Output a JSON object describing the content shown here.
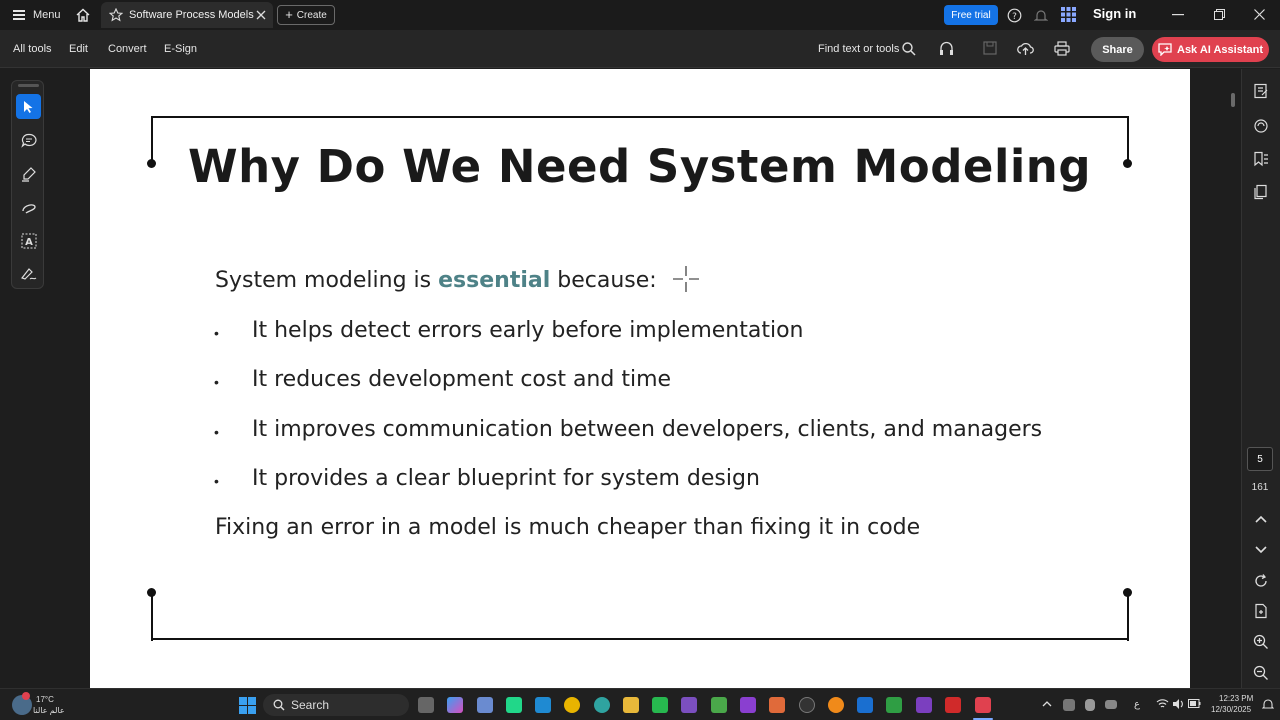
{
  "titlebar": {
    "menu_label": "Menu",
    "tab_title": "Software Process Models",
    "create_label": "Create",
    "free_trial_label": "Free trial",
    "sign_in_label": "Sign in"
  },
  "menubar": {
    "items": [
      "All tools",
      "Edit",
      "Convert",
      "E-Sign"
    ],
    "find_placeholder": "Find text or tools",
    "share_label": "Share",
    "ai_label": "Ask AI Assistant"
  },
  "slide": {
    "title": "Why Do We Need System Modeling",
    "intro_prefix": "System modeling is ",
    "intro_highlight": "essential",
    "intro_suffix": " because:",
    "bullets": [
      "It helps detect errors early before implementation",
      "It reduces development cost and time",
      "It improves communication between developers, clients, and managers",
      "It provides a clear blueprint for system design"
    ],
    "conclusion": "Fixing an error in a model is much cheaper than fixing it in code",
    "highlight_color": "#4e8287"
  },
  "navigation": {
    "current_page": "5",
    "total_pages": "161"
  },
  "taskbar": {
    "search_label": "Search",
    "weather_temp": "17°C",
    "weather_caption": "عالم عالنا",
    "time": "12:23 PM",
    "date": "12/30/2025",
    "lang": "ع"
  },
  "colors": {
    "accent": "#1473e6",
    "ai_button": "#e0414f"
  }
}
